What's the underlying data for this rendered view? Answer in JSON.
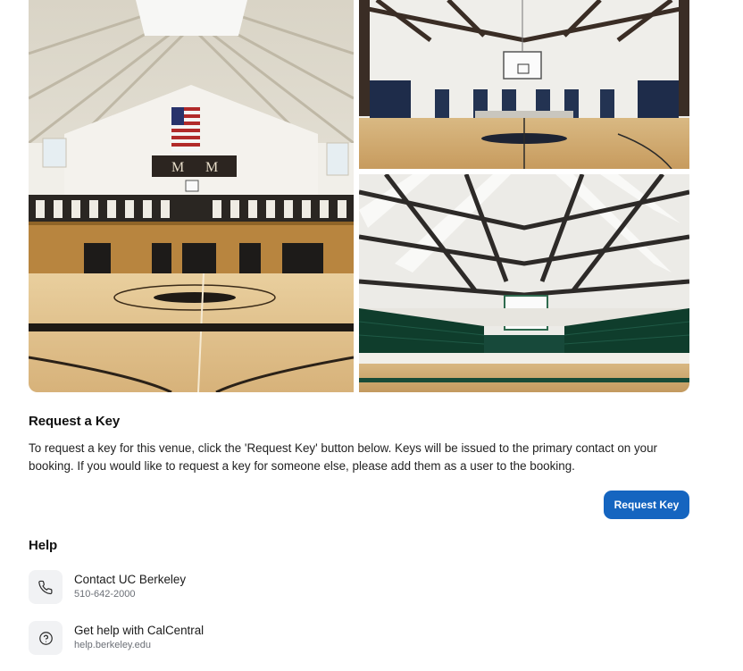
{
  "gallery": {
    "images": [
      {
        "alt": "Gymnasium interior with skylights and flag"
      },
      {
        "alt": "Basketball court with dark blue wall padding"
      },
      {
        "alt": "Gym with green bleachers and steel trusses"
      }
    ]
  },
  "request_key": {
    "title": "Request a Key",
    "body": "To request a key for this venue, click the 'Request Key' button below. Keys will be issued to the primary contact on your booking. If you would like to request a key for someone else, please add them as a user to the booking.",
    "button_label": "Request Key",
    "button_color": "#1565c0"
  },
  "help": {
    "title": "Help",
    "items": [
      {
        "label": "Contact UC Berkeley",
        "sub": "510-642-2000",
        "icon": "phone-icon"
      },
      {
        "label": "Get help with CalCentral",
        "sub": "help.berkeley.edu",
        "icon": "question-circle-icon"
      }
    ]
  }
}
